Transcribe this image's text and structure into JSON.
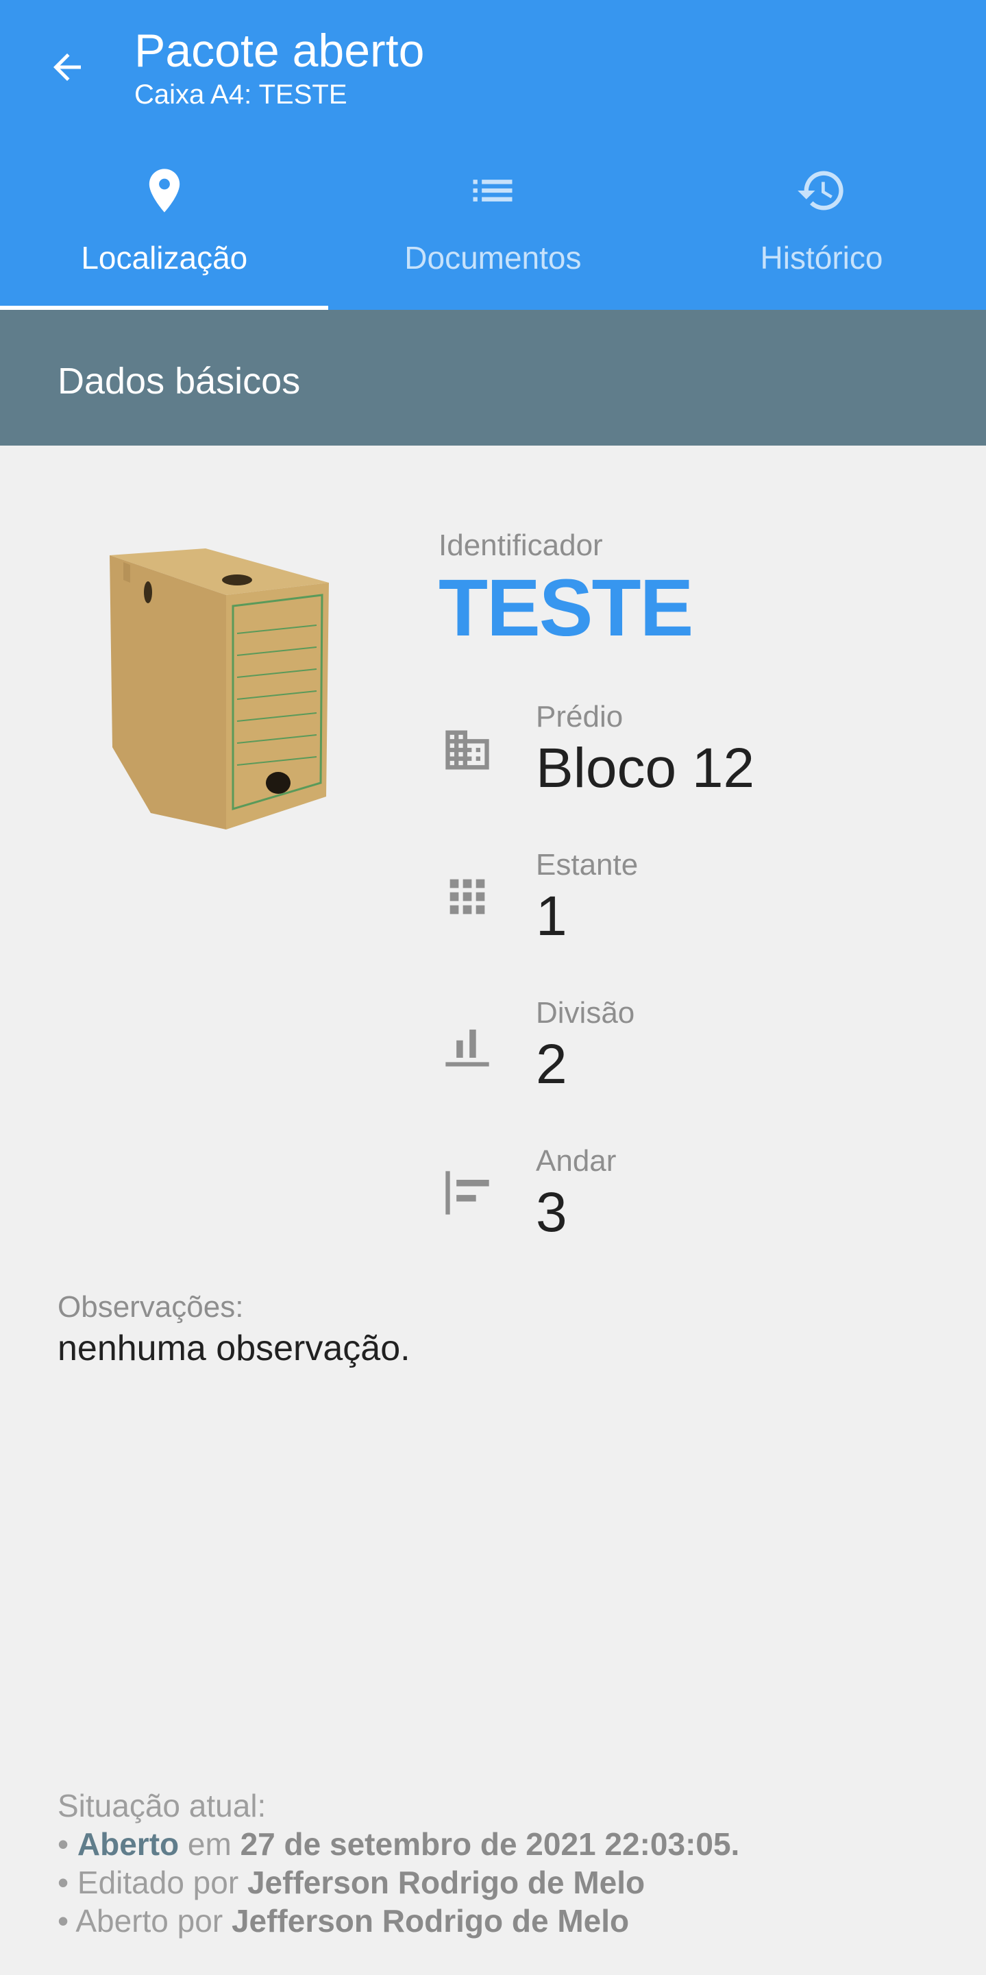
{
  "header": {
    "title": "Pacote aberto",
    "subtitle": "Caixa A4: TESTE"
  },
  "tabs": [
    {
      "label": "Localização",
      "icon": "location-pin-icon",
      "active": true
    },
    {
      "label": "Documentos",
      "icon": "list-icon",
      "active": false
    },
    {
      "label": "Histórico",
      "icon": "history-icon",
      "active": false
    }
  ],
  "section": {
    "title": "Dados básicos"
  },
  "details": {
    "identifier_label": "Identificador",
    "identifier": "TESTE",
    "fields": [
      {
        "label": "Prédio",
        "value": "Bloco 12",
        "icon": "building-icon"
      },
      {
        "label": "Estante",
        "value": "1",
        "icon": "grid-icon"
      },
      {
        "label": "Divisão",
        "value": "2",
        "icon": "division-icon"
      },
      {
        "label": "Andar",
        "value": "3",
        "icon": "floor-icon"
      }
    ]
  },
  "observations": {
    "label": "Observações:",
    "value": "nenhuma observação."
  },
  "status": {
    "label": "Situação atual:",
    "bullet": "•",
    "state": "Aberto",
    "state_connector": "em",
    "state_date": "27 de setembro de 2021 22:03:05.",
    "edited_prefix": "Editado por",
    "edited_by": "Jefferson Rodrigo de Melo",
    "opened_prefix": "Aberto por",
    "opened_by": "Jefferson Rodrigo de Melo"
  },
  "colors": {
    "primary": "#3796ef",
    "section_header": "#607d8b",
    "background": "#f0f0f0"
  }
}
